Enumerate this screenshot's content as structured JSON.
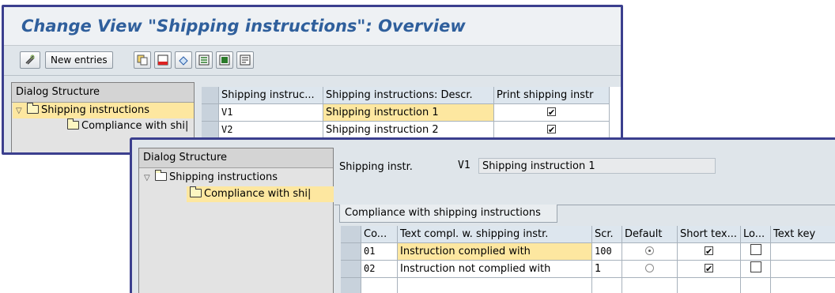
{
  "window1": {
    "title": "Change View \"Shipping instructions\": Overview",
    "toolbar": {
      "new_entries_label": "New entries",
      "icons": [
        "edit-glasses-icon",
        "copy-icon",
        "delete-icon",
        "undo-icon",
        "select-all-icon",
        "select-block-icon",
        "deselect-icon"
      ]
    },
    "dialog_structure": {
      "header": "Dialog Structure",
      "items": [
        {
          "label": "Shipping instructions"
        },
        {
          "label": "Compliance with shi|"
        }
      ]
    },
    "table": {
      "columns": [
        "Shipping instruc...",
        "Shipping instructions: Descr.",
        "Print shipping instr"
      ],
      "rows": [
        {
          "code": "V1",
          "descr": "Shipping instruction 1",
          "print": true
        },
        {
          "code": "V2",
          "descr": "Shipping instruction 2",
          "print": true
        }
      ]
    }
  },
  "window2": {
    "dialog_structure": {
      "header": "Dialog Structure",
      "items": [
        {
          "label": "Shipping instructions"
        },
        {
          "label": "Compliance with shi|"
        }
      ]
    },
    "shipping_instr": {
      "label": "Shipping instr.",
      "code": "V1",
      "value": "Shipping instruction 1"
    },
    "tab_label": "Compliance with shipping instructions",
    "table": {
      "columns": [
        "Co...",
        "Text compl. w. shipping instr.",
        "Scr.",
        "Default",
        "Short tex...",
        "Lo...",
        "Text key"
      ],
      "rows": [
        {
          "code": "01",
          "text": "Instruction complied with",
          "scr": "100",
          "default": true,
          "short": true,
          "lo": false,
          "key": ""
        },
        {
          "code": "02",
          "text": "Instruction not complied with",
          "scr": "1",
          "default": false,
          "short": true,
          "lo": false,
          "key": ""
        }
      ]
    }
  },
  "colors": {
    "window_border": "#3b3f8e",
    "title_text": "#2f5f9c",
    "highlight": "#fde7a0"
  }
}
